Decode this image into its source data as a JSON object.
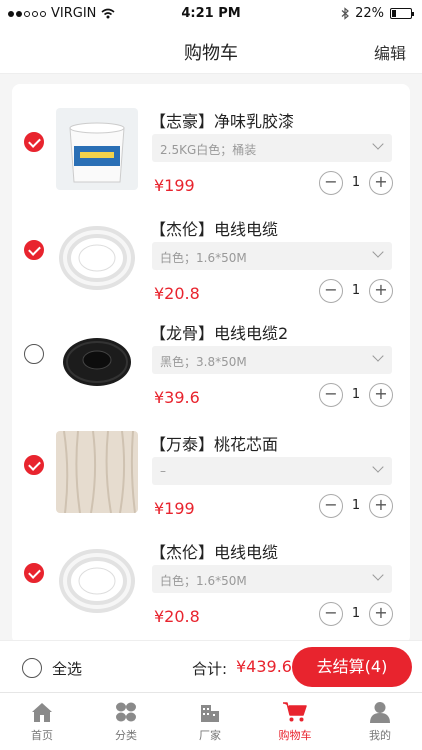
{
  "status_bar": {
    "carrier": "VIRGIN",
    "time": "4:21 PM",
    "battery": "22%",
    "battery_level": 0.22
  },
  "nav": {
    "title": "购物车",
    "edit_label": "编辑"
  },
  "cart": {
    "items": [
      {
        "title": "【志豪】净味乳胶漆",
        "spec": "2.5KG白色；桶装",
        "price": "¥199",
        "qty": "1",
        "checked": true,
        "image": "paint-bucket-image"
      },
      {
        "title": "【杰伦】电线电缆",
        "spec": "白色；1.6*50M",
        "price": "¥20.8",
        "qty": "1",
        "checked": true,
        "image": "white-cable-image"
      },
      {
        "title": "【龙骨】电线电缆2",
        "spec": "黑色；3.8*50M",
        "price": "¥39.6",
        "qty": "1",
        "checked": false,
        "image": "black-cable-image"
      },
      {
        "title": "【万泰】桃花芯面",
        "spec": "–",
        "price": "¥199",
        "qty": "1",
        "checked": true,
        "image": "wood-panel-image"
      },
      {
        "title": "【杰伦】电线电缆",
        "spec": "白色；1.6*50M",
        "price": "¥20.8",
        "qty": "1",
        "checked": true,
        "image": "white-cable-image"
      }
    ],
    "minus_label": "−",
    "plus_label": "+"
  },
  "checkout": {
    "select_all_label": "全选",
    "total_label": "合计:",
    "total_value": "¥439.6",
    "button_label": "去结算(4)"
  },
  "tabs": [
    {
      "label": "首页",
      "icon": "home-icon",
      "active": false
    },
    {
      "label": "分类",
      "icon": "category-icon",
      "active": false
    },
    {
      "label": "厂家",
      "icon": "factory-icon",
      "active": false
    },
    {
      "label": "购物车",
      "icon": "cart-icon",
      "active": true
    },
    {
      "label": "我的",
      "icon": "profile-icon",
      "active": false
    }
  ],
  "colors": {
    "accent": "#e8242e",
    "background": "#f5f5f5"
  }
}
